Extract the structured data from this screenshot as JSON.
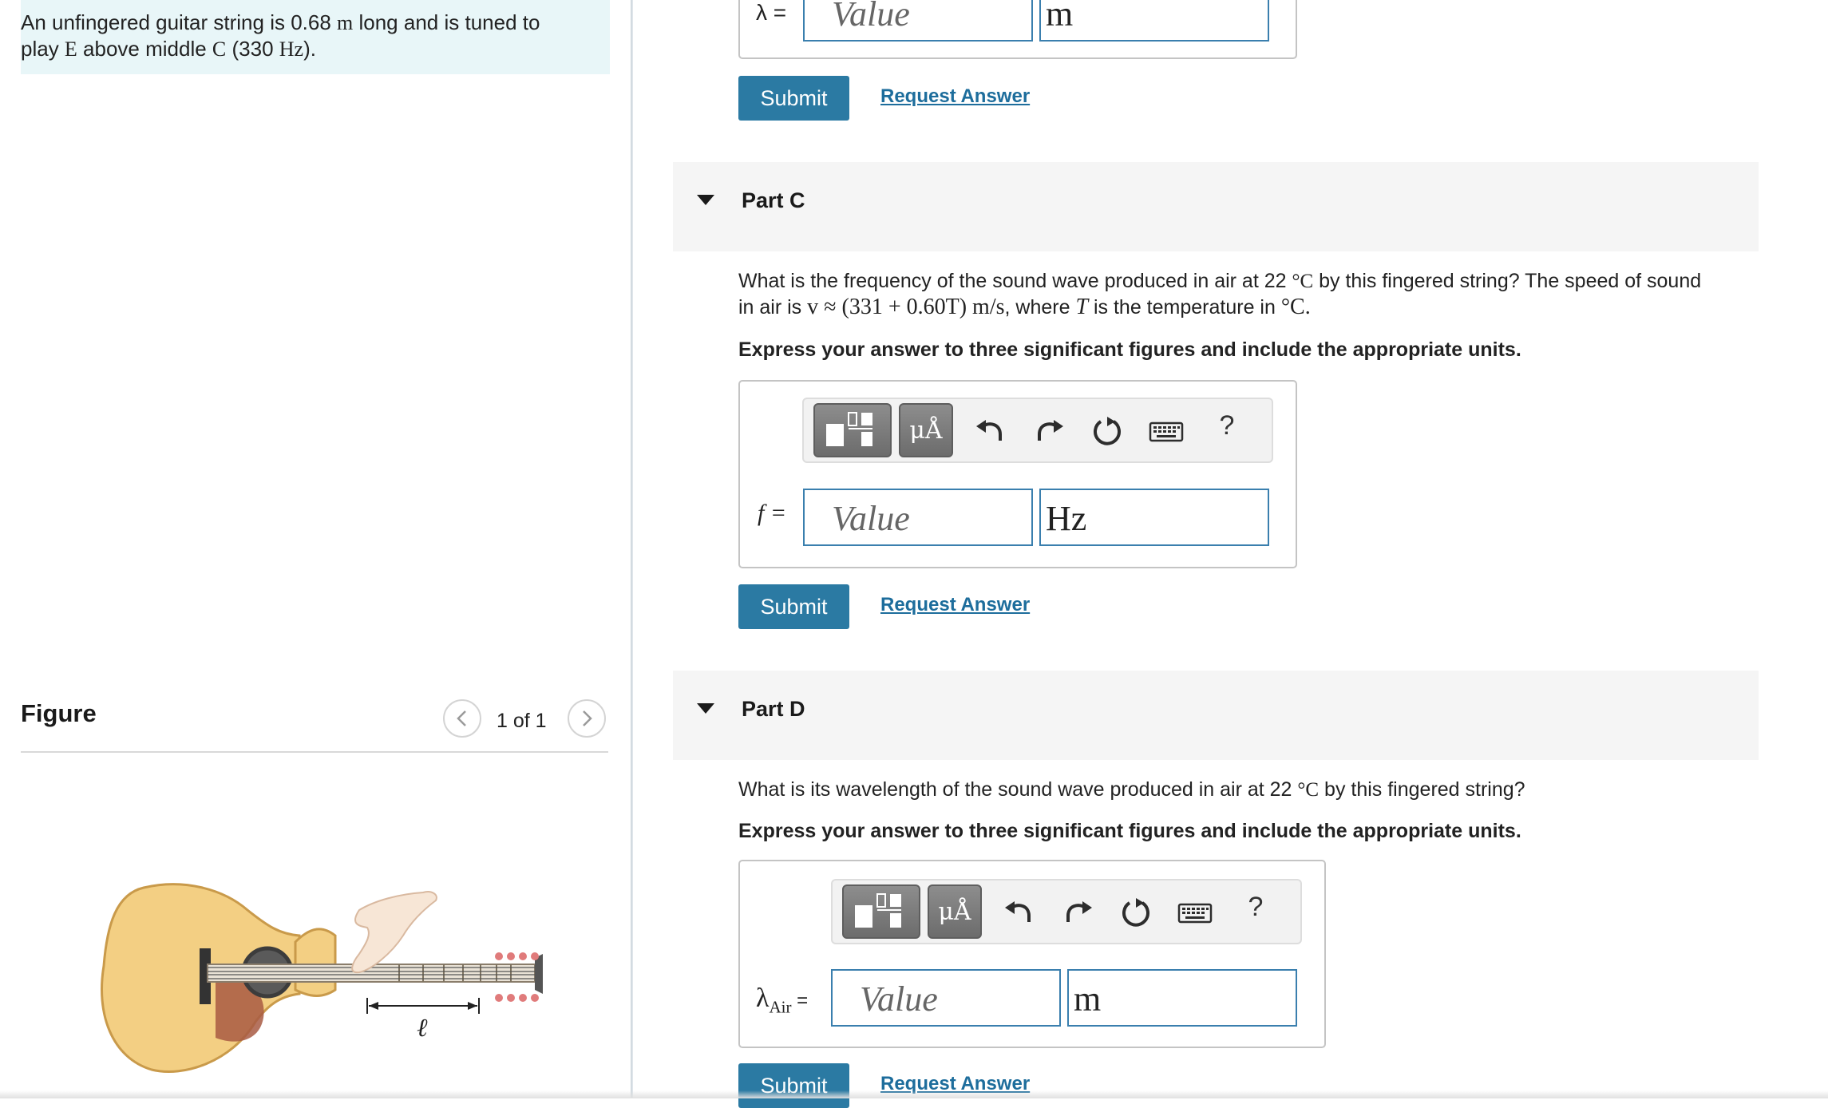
{
  "problem": {
    "line1_pre": "An unfingered guitar string is 0.68 ",
    "line1_unit": "m",
    "line1_post": " long and is tuned to",
    "line2_pre": "play ",
    "line2_note": "E",
    "line2_mid": " above middle ",
    "line2_note2": "C",
    "line2_paren": " (330 ",
    "line2_unit": "Hz",
    "line2_end": ")."
  },
  "figure": {
    "title": "Figure",
    "counter": "1 of 1",
    "length_label": "ℓ"
  },
  "part_b": {
    "var_label": "λ =",
    "value_placeholder": "Value",
    "unit": "m",
    "submit": "Submit",
    "request": "Request Answer"
  },
  "part_c": {
    "title": "Part C",
    "question_1": "What is the frequency of the sound wave produced in air at 22 ",
    "question_deg": "°C",
    "question_2": " by this fingered string? The speed of sound",
    "question_3": "in air is ",
    "question_math": "v ≈ (331 + 0.60T) m/s",
    "question_4": ", where ",
    "question_T": "T",
    "question_5": " is the temperature in ",
    "question_6": "°C.",
    "instruction": "Express your answer to three significant figures and include the appropriate units.",
    "var_label": "f =",
    "value_placeholder": "Value",
    "unit": "Hz",
    "submit": "Submit",
    "request": "Request Answer"
  },
  "part_d": {
    "title": "Part D",
    "question_1": "What is its wavelength of the sound wave produced in air at 22 ",
    "question_deg": "°C",
    "question_2": " by this fingered string?",
    "instruction": "Express your answer to three significant figures and include the appropriate units.",
    "var_label": "λ",
    "var_sub": "Air",
    "var_eq": " =",
    "value_placeholder": "Value",
    "unit": "m",
    "submit": "Submit",
    "request": "Request Answer"
  },
  "toolbar": {
    "units_button": "μÅ",
    "help": "?",
    "icons": [
      "templates-icon",
      "units-icon",
      "undo-icon",
      "redo-icon",
      "reset-icon",
      "keyboard-icon",
      "help-icon"
    ]
  },
  "colors": {
    "accent": "#2b7aa3",
    "link": "#1d6d9c",
    "problem_bg": "#e8f6f8",
    "field_border": "#3a7fae"
  }
}
